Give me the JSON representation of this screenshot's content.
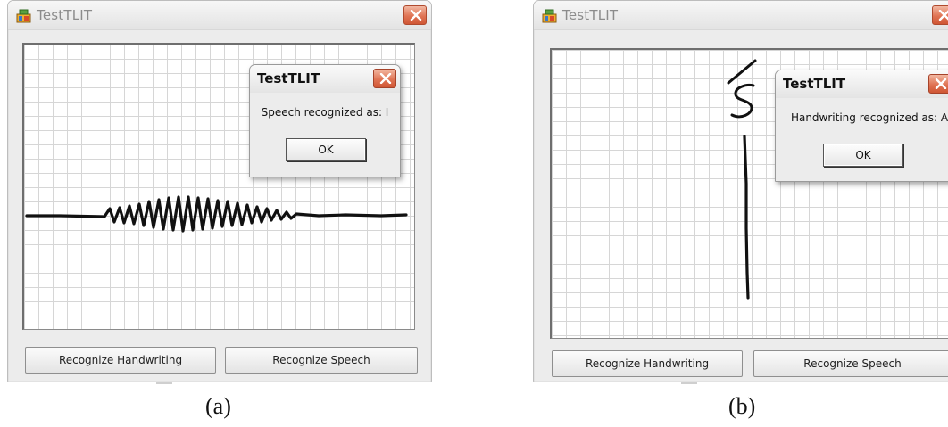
{
  "panel_a": {
    "window_title": "TestTLIT",
    "buttons": {
      "handwriting": "Recognize Handwriting",
      "speech": "Recognize Speech"
    },
    "dialog": {
      "title": "TestTLIT",
      "message": "Speech recognized as: I",
      "ok_label": "OK"
    },
    "caption": "(a)"
  },
  "panel_b": {
    "window_title": "TestTLIT",
    "buttons": {
      "handwriting": "Recognize Handwriting",
      "speech": "Recognize Speech"
    },
    "dialog": {
      "title": "TestTLIT",
      "message": "Handwriting recognized as: A",
      "ok_label": "OK"
    },
    "caption": "(b)"
  },
  "icons": [
    "app-icon",
    "close-icon"
  ],
  "colors": {
    "close_button": "#e07454",
    "grid_line": "#d6d6d6",
    "title_text": "#8c8c8c"
  }
}
